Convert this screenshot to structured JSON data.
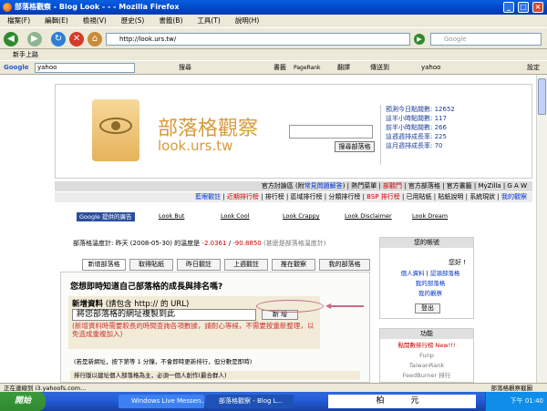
{
  "window": {
    "title": "部落格觀察 - Blog Look - - - Mozilla Firefox"
  },
  "menu": [
    "檔案(F)",
    "編輯(E)",
    "檢視(V)",
    "歷史(S)",
    "書籤(B)",
    "工具(T)",
    "說明(H)"
  ],
  "nav": {
    "url": "http://look.urs.tw/",
    "search_placeholder": "Google"
  },
  "bookmarks": {
    "item": "新手上路"
  },
  "googlebar": {
    "label": "Google",
    "query": "yahoo",
    "search": "搜尋",
    "bookmarks": "書籤",
    "pagerank": "PageRank",
    "translate": "翻譯",
    "sendto": "傳送到",
    "query2": "yahoo",
    "settings": "設定"
  },
  "site": {
    "logo_text": "部落格觀察",
    "logo_url": "look.urs.tw",
    "search_button": "搜尋部落格",
    "stats": [
      "預測今日點閱數: 12652",
      "這半小時點閱數: 117",
      "前半小時點閱數: 266",
      "這週週排成長率: 225",
      "這月週排成長率: 70"
    ],
    "nav_row1": [
      "官方討論區 (附",
      "常見問題解答",
      ")",
      "熱門菜單",
      "部觀門",
      "官方部落格",
      "官方書籤",
      "MyZilla",
      "G A W"
    ],
    "nav_row2": [
      "藍眼觀註",
      "近期排行榜",
      "排行榜",
      "區域排行榜",
      "分類排行榜",
      "BSP 排行榜",
      "已用貼紙",
      "貼紙說明",
      "系統現狀",
      "我的觀察"
    ],
    "ads": [
      "Google 提供的廣告",
      "Look But",
      "Look Cool",
      "Look Crappy",
      "Look Disclaimer",
      "Look Dream"
    ],
    "temp_prefix": "部落格溫度計: 昨天 (2008-05-30) 的溫度是",
    "temp1": "-2.0361",
    "temp_sep": "/",
    "temp2": "-90.8850",
    "temp_suffix": "(甚麼是部落格溫度計)",
    "tabs": [
      "新增部落格",
      "取得貼紙",
      "昨日觀註",
      "上週觀註",
      "推在觀察",
      "我的部落格"
    ],
    "question": "您想即時知道自己部落格的成長與排名嗎?",
    "add_title": "新增資料",
    "add_hint": "(請包含 http:// 的 URL)",
    "add_instruction": "將您部落格的網址複製到此",
    "add_button": "新 增",
    "add_note": "(新增資料時需要較長的時間查詢各項數據，請耐心等候，不需要按重新整理，以免造成重複加入)",
    "add_note2": "(若是新網址，按下第等 1 分鐘，不會即時更新排行，但分數是即時)",
    "add_note3": "排行版以建址個人部落格為主，必須一個人創作(最合群人)",
    "account_title": "您的帳號",
    "greeting": "您好 !",
    "account_links": [
      "個人資料",
      "認領部落格",
      "我的部落格",
      "我的觀察"
    ],
    "logout": "登出",
    "features_title": "功能",
    "features": [
      "點閱數排行榜 New!!!",
      "Funp",
      "TaiwanRank",
      "FeedBurner 排行"
    ]
  },
  "status": {
    "text": "正在連線到 i3.yahoofs.com...",
    "right": "部落格觀察截圖"
  },
  "taskbar": {
    "start": "開始",
    "tasks": [
      "Windows Live Messen...",
      "部落格觀察 - Blog L..."
    ],
    "ime": "柏　元",
    "clock": "下午 01:40"
  }
}
